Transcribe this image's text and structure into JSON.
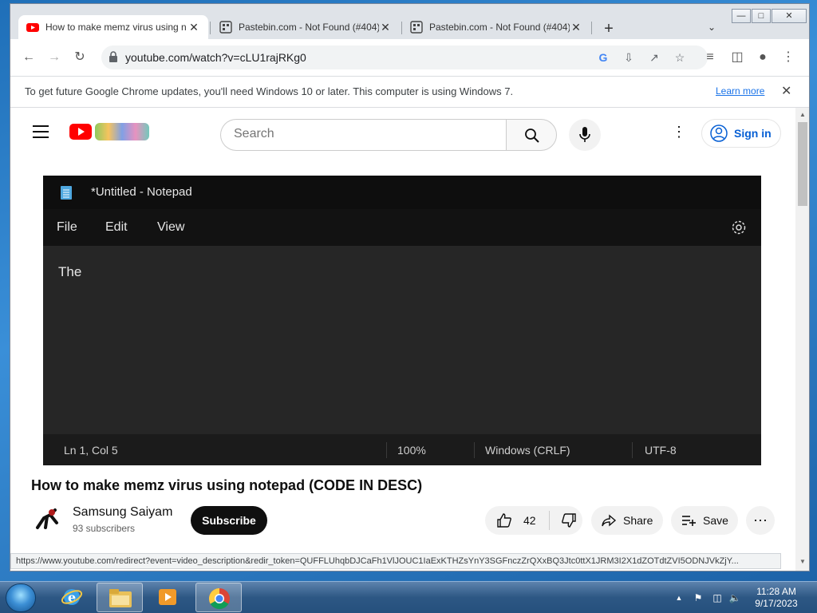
{
  "browser": {
    "tabs": [
      {
        "title": "How to make memz virus using n",
        "icon": "youtube-favicon"
      },
      {
        "title": "Pastebin.com - Not Found (#404)",
        "icon": "pastebin-favicon"
      },
      {
        "title": "Pastebin.com - Not Found (#404)",
        "icon": "pastebin-favicon"
      }
    ],
    "url": "youtube.com/watch?v=cLU1rajRKg0",
    "infobar_text": "To get future Google Chrome updates, you'll need Windows 10 or later. This computer is using Windows 7.",
    "learn_more": "Learn more",
    "status_url": "https://www.youtube.com/redirect?event=video_description&redir_token=QUFFLUhqbDJCaFh1VlJOUC1IaExKTHZsYnY3SGFnczZrQXxBQ3Jtc0ttX1JRM3I2X1dZOTdtZVI5ODNJVkZjY..."
  },
  "youtube": {
    "search_placeholder": "Search",
    "sign_in": "Sign in",
    "video_title": "How to make memz virus using notepad (CODE IN DESC)",
    "channel_name": "Samsung Saiyam",
    "subscribers": "93 subscribers",
    "subscribe": "Subscribe",
    "likes": "42",
    "share": "Share",
    "save": "Save"
  },
  "video_frame": {
    "notepad_title": "*Untitled - Notepad",
    "menu": [
      "File",
      "Edit",
      "View"
    ],
    "content": "The",
    "status": {
      "position": "Ln 1, Col 5",
      "zoom": "100%",
      "line_ending": "Windows (CRLF)",
      "encoding": "UTF-8"
    }
  },
  "taskbar": {
    "time": "11:28 AM",
    "date": "9/17/2023"
  }
}
